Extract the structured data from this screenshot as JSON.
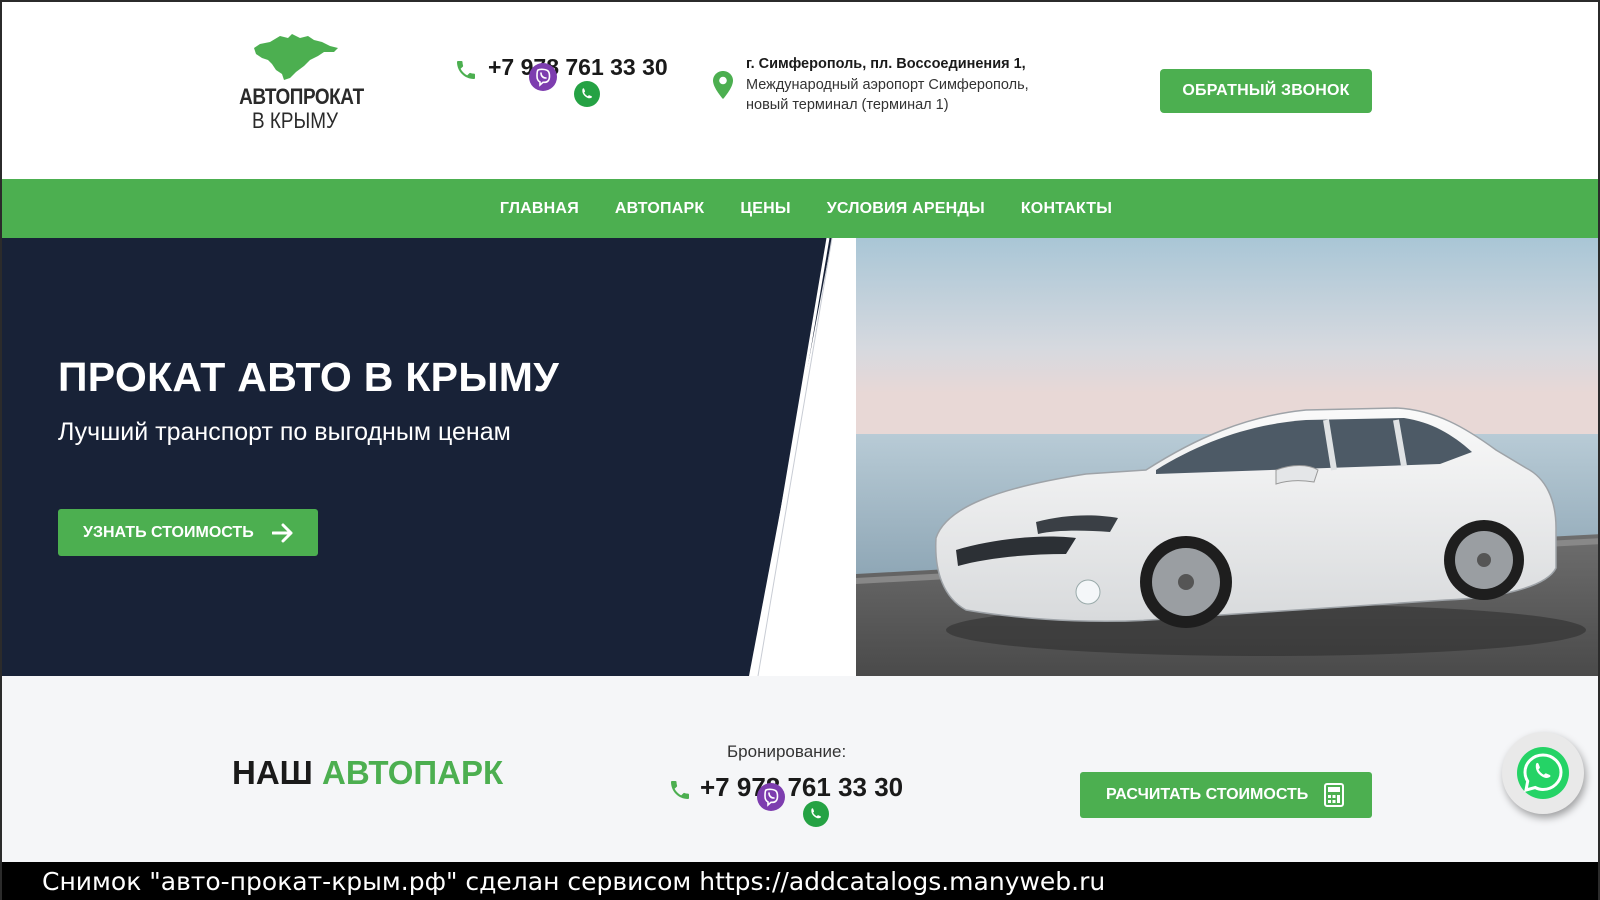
{
  "logo": {
    "line1": "АВТОПРОКАТ",
    "line2": "В КРЫМУ"
  },
  "header": {
    "phone": "+7 978 761 33 30",
    "address_line1": "г. Симферополь, пл. Воссоединения 1,",
    "address_line2": "Международный аэропорт Симферополь,",
    "address_line3": "новый терминал (терминал 1)",
    "callback_label": "ОБРАТНЫЙ ЗВОНОК"
  },
  "nav": {
    "items": [
      {
        "label": "ГЛАВНАЯ"
      },
      {
        "label": "АВТОПАРК"
      },
      {
        "label": "ЦЕНЫ"
      },
      {
        "label": "УСЛОВИЯ АРЕНДЫ"
      },
      {
        "label": "КОНТАКТЫ"
      }
    ]
  },
  "hero": {
    "title": "ПРОКАТ АВТО В КРЫМУ",
    "subtitle": "Лучший транспорт по выгодным ценам",
    "button_label": "УЗНАТЬ СТОИМОСТЬ"
  },
  "park": {
    "title_dark": "НАШ",
    "title_accent": "АВТОПАРК",
    "booking_label": "Бронирование:",
    "phone": "+7 978 761 33 30",
    "calc_label": "РАСЧИТАТЬ СТОИМОСТЬ"
  },
  "caption": "Снимок \"авто-прокат-крым.рф\" сделан сервисом https://addcatalogs.manyweb.ru",
  "colors": {
    "accent": "#4caf50",
    "hero_dark": "#182237",
    "viber": "#7d3daf",
    "whatsapp": "#25a244"
  },
  "icons": [
    "crimea-map-icon",
    "phone-icon",
    "viber-icon",
    "whatsapp-icon",
    "map-pin-icon",
    "arrow-right-icon",
    "calculator-icon"
  ]
}
